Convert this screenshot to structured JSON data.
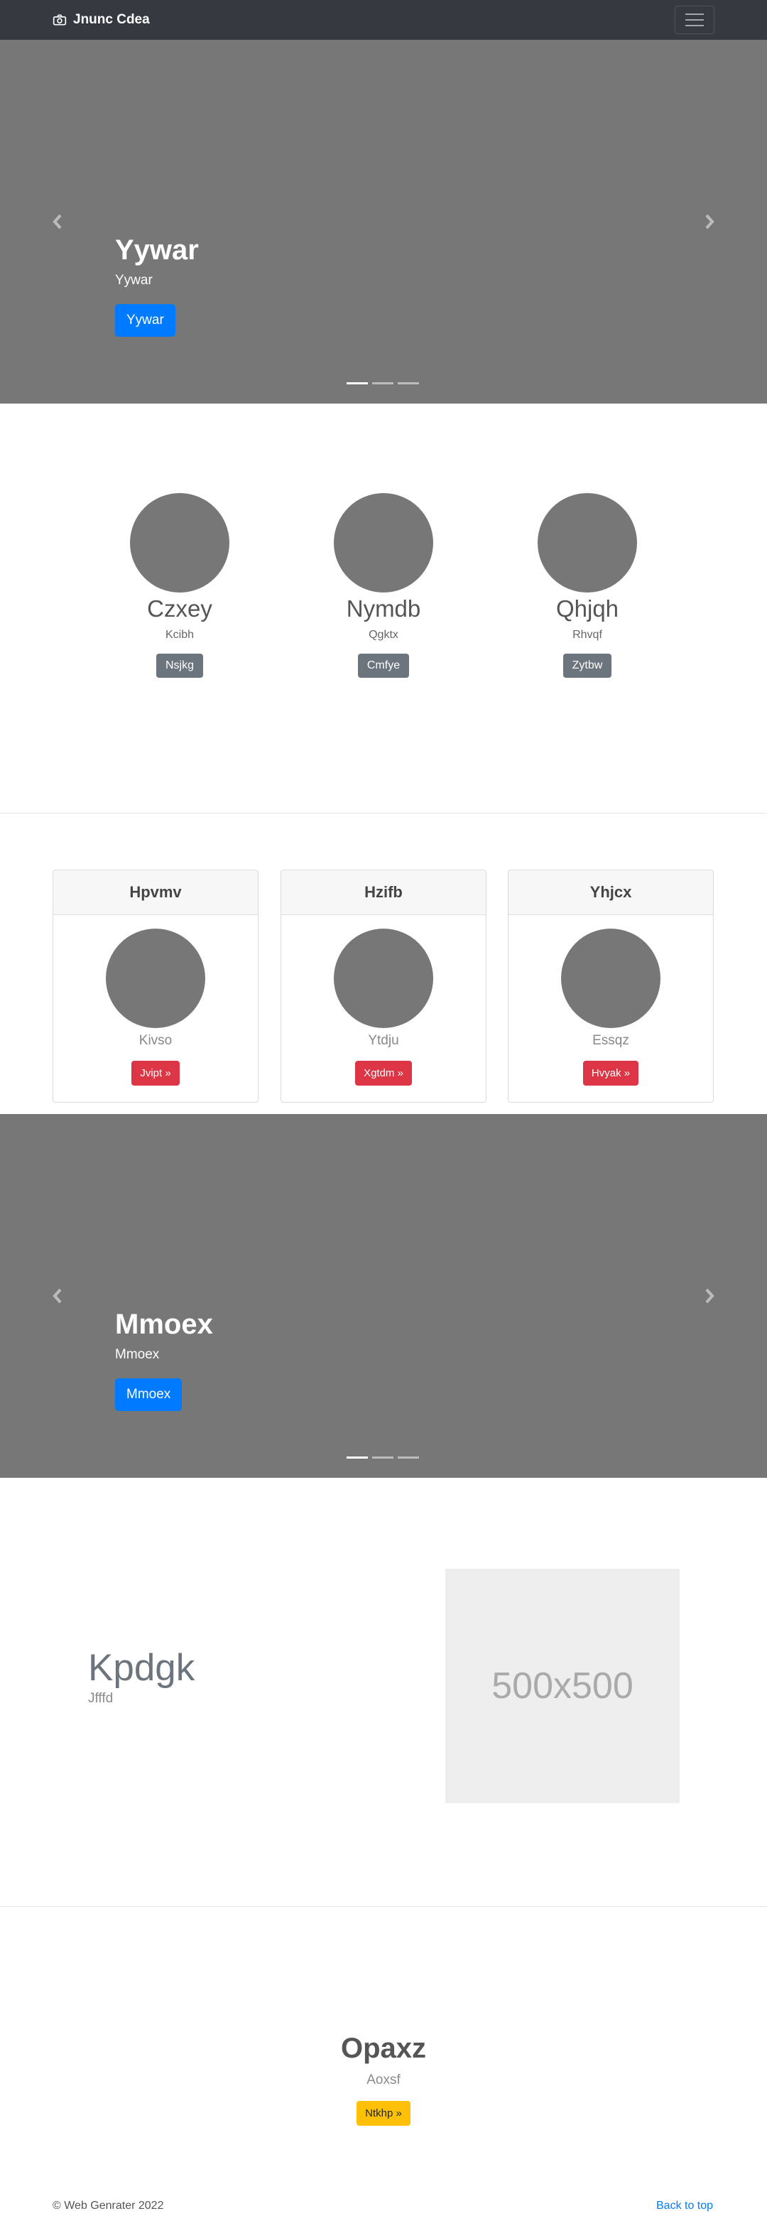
{
  "navbar": {
    "brand": "Jnunc Cdea",
    "brand_icon": "camera-icon",
    "toggler_icon": "hamburger-icon"
  },
  "carousel1": {
    "title": "Yywar",
    "text": "Yywar",
    "button": "Yywar",
    "slides": 3,
    "active_slide": 1
  },
  "circles": [
    {
      "title": "Czxey",
      "text": "Kcibh",
      "button": "Nsjkg"
    },
    {
      "title": "Nymdb",
      "text": "Qgktx",
      "button": "Cmfye"
    },
    {
      "title": "Qhjqh",
      "text": "Rhvqf",
      "button": "Zytbw"
    }
  ],
  "cards": [
    {
      "header": "Hpvmv",
      "text": "Kivso",
      "button": "Jvipt »"
    },
    {
      "header": "Hzifb",
      "text": "Ytdju",
      "button": "Xgtdm »"
    },
    {
      "header": "Yhjcx",
      "text": "Essqz",
      "button": "Hvyak »"
    }
  ],
  "carousel2": {
    "title": "Mmoex",
    "text": "Mmoex",
    "button": "Mmoex",
    "slides": 3,
    "active_slide": 1
  },
  "feature": {
    "title": "Kpdgk",
    "text": "Jfffd",
    "image_label": "500x500"
  },
  "cta": {
    "title": "Opaxz",
    "text": "Aoxsf",
    "button": "Ntkhp »"
  },
  "footer": {
    "copyright": "© Web Genrater 2022",
    "back_to_top": "Back to top"
  },
  "colors": {
    "navbar": "#343a40",
    "carousel": "#777777",
    "primary": "#007bff",
    "secondary": "#6c757d",
    "danger": "#dc3545",
    "warning": "#ffc107"
  }
}
